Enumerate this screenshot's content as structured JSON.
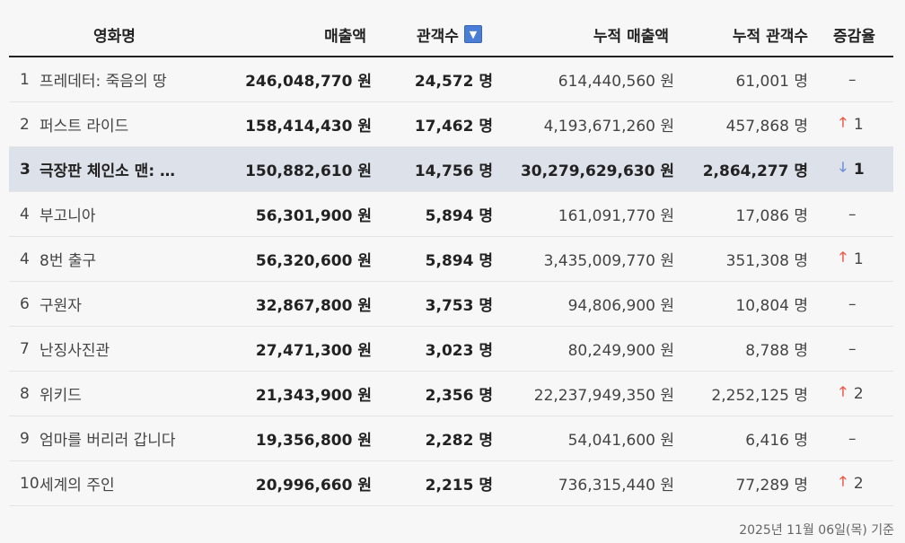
{
  "headers": {
    "title": "영화명",
    "sales": "매출액",
    "audience": "관객수",
    "cum_sales": "누적 매출액",
    "cum_audience": "누적 관객수",
    "change": "증감율"
  },
  "sort_icon": "▼",
  "rows": [
    {
      "rank": "1",
      "title": "프레데터: 죽음의 땅",
      "sales": "246,048,770 원",
      "audience": "24,572 명",
      "cum_sales": "614,440,560 원",
      "cum_audience": "61,001 명",
      "change_dir": "none",
      "change_arrow": "",
      "change_val": "–"
    },
    {
      "rank": "2",
      "title": "퍼스트 라이드",
      "sales": "158,414,430 원",
      "audience": "17,462 명",
      "cum_sales": "4,193,671,260 원",
      "cum_audience": "457,868 명",
      "change_dir": "up",
      "change_arrow": "🡑",
      "change_val": "1"
    },
    {
      "rank": "3",
      "title": "극장판 체인소 맨: …",
      "sales": "150,882,610 원",
      "audience": "14,756 명",
      "cum_sales": "30,279,629,630 원",
      "cum_audience": "2,864,277 명",
      "change_dir": "down",
      "change_arrow": "🡓",
      "change_val": "1"
    },
    {
      "rank": "4",
      "title": "부고니아",
      "sales": "56,301,900 원",
      "audience": "5,894 명",
      "cum_sales": "161,091,770 원",
      "cum_audience": "17,086 명",
      "change_dir": "none",
      "change_arrow": "",
      "change_val": "–"
    },
    {
      "rank": "4",
      "title": "8번 출구",
      "sales": "56,320,600 원",
      "audience": "5,894 명",
      "cum_sales": "3,435,009,770 원",
      "cum_audience": "351,308 명",
      "change_dir": "up",
      "change_arrow": "🡑",
      "change_val": "1"
    },
    {
      "rank": "6",
      "title": "구원자",
      "sales": "32,867,800 원",
      "audience": "3,753 명",
      "cum_sales": "94,806,900 원",
      "cum_audience": "10,804 명",
      "change_dir": "none",
      "change_arrow": "",
      "change_val": "–"
    },
    {
      "rank": "7",
      "title": "난징사진관",
      "sales": "27,471,300 원",
      "audience": "3,023 명",
      "cum_sales": "80,249,900 원",
      "cum_audience": "8,788 명",
      "change_dir": "none",
      "change_arrow": "",
      "change_val": "–"
    },
    {
      "rank": "8",
      "title": "위키드",
      "sales": "21,343,900 원",
      "audience": "2,356 명",
      "cum_sales": "22,237,949,350 원",
      "cum_audience": "2,252,125 명",
      "change_dir": "up",
      "change_arrow": "🡑",
      "change_val": "2"
    },
    {
      "rank": "9",
      "title": "엄마를 버리러 갑니다",
      "sales": "19,356,800 원",
      "audience": "2,282 명",
      "cum_sales": "54,041,600 원",
      "cum_audience": "6,416 명",
      "change_dir": "none",
      "change_arrow": "",
      "change_val": "–"
    },
    {
      "rank": "10",
      "title": "세계의 주인",
      "sales": "20,996,660 원",
      "audience": "2,215 명",
      "cum_sales": "736,315,440 원",
      "cum_audience": "77,289 명",
      "change_dir": "up",
      "change_arrow": "🡑",
      "change_val": "2"
    }
  ],
  "highlight_index": 2,
  "footer": "2025년 11월 06일(목) 기준",
  "colors": {
    "up": "#ee5a4a",
    "down": "#6b8fd6",
    "highlight": "#dde1ea",
    "sort_button": "#4a7dd6"
  }
}
